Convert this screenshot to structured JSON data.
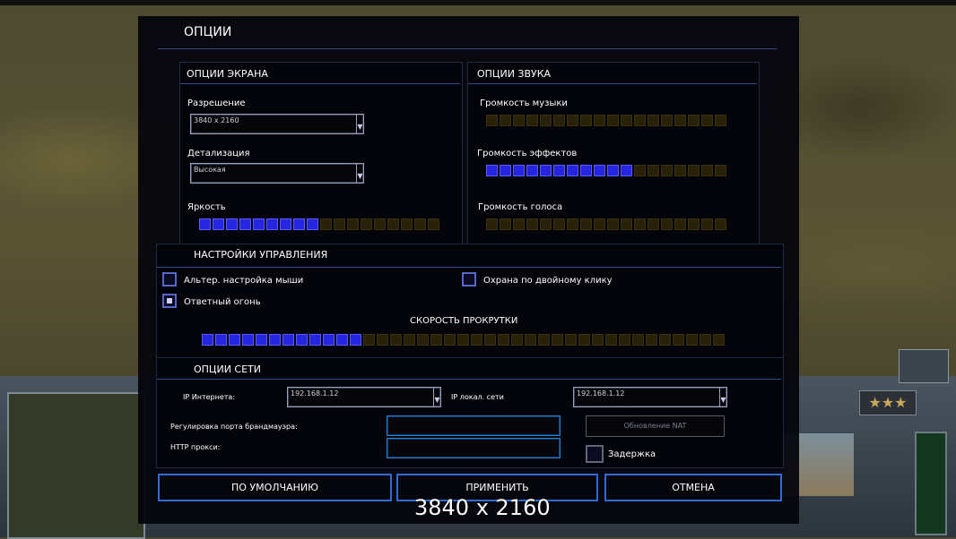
{
  "title": "ОПЦИИ",
  "screen": {
    "header": "ОПЦИИ ЭКРАНА",
    "resolution_label": "Разрешение",
    "resolution_value": "3840 x 2160",
    "detail_label": "Детализация",
    "detail_value": "Высокая",
    "brightness_label": "Яркость",
    "brightness_level": 0.5,
    "brightness_segments": 18
  },
  "sound": {
    "header": "ОПЦИИ ЗВУКА",
    "music_label": "Громкость музыки",
    "music_level": 0,
    "effects_label": "Громкость эффектов",
    "effects_level": 0.61,
    "voice_label": "Громкость голоса",
    "voice_level": 0,
    "segments": 18
  },
  "controls": {
    "header": "НАСТРОЙКИ УПРАВЛЕНИЯ",
    "alt_mouse_label": "Альтер. настройка мыши",
    "alt_mouse_checked": false,
    "double_click_guard_label": "Охрана по двойному клику",
    "double_click_guard_checked": false,
    "return_fire_label": "Ответный огонь",
    "return_fire_checked": true,
    "scroll_speed_label": "СКОРОСТЬ ПРОКРУТКИ",
    "scroll_speed_level": 0.3,
    "scroll_segments": 39
  },
  "network": {
    "header": "ОПЦИИ СЕТИ",
    "internet_ip_label": "IP Интернета:",
    "internet_ip_value": "192.168.1.12",
    "local_ip_label": "IP локал. сети",
    "local_ip_value": "192.168.1.12",
    "firewall_label": "Регулировка порта брандмауэра:",
    "firewall_value": "",
    "nat_update_label": "Обновление NAT",
    "http_proxy_label": "HTTP прокси:",
    "http_proxy_value": "",
    "delay_label": "Задержка",
    "delay_checked": false
  },
  "buttons": {
    "defaults": "ПО УМОЛЧАНИЮ",
    "apply": "ПРИМЕНИТЬ",
    "cancel": "ОТМЕНА"
  },
  "overlay_resolution": "3840 x 2160",
  "hud": {
    "stars": "★★★"
  },
  "colors": {
    "segment_on": "#2626e0",
    "segment_off": "#2a2208",
    "accent_border": "#2f6ad8"
  }
}
